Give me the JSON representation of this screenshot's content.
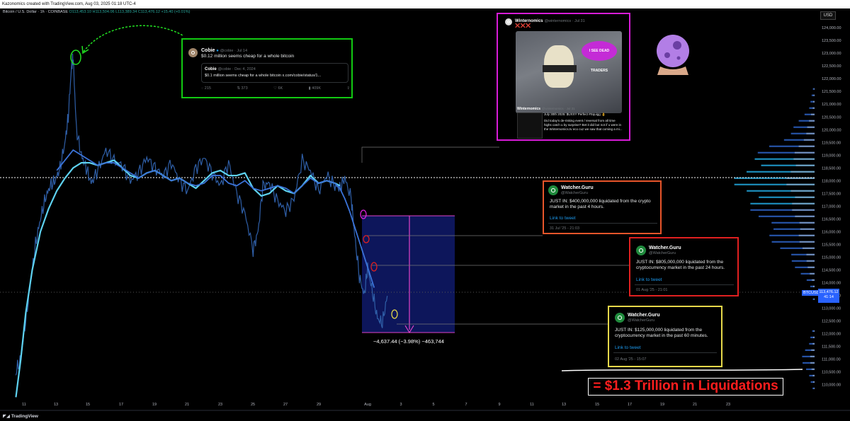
{
  "header": {
    "attribution": "Kazonomics created with TradingView.com, Aug 03, 2025 01:18 UTC-4",
    "symbol": "Bitcoin / U.S. Dollar · 1h · COINBASE",
    "ohlc_o": "O113,453.10",
    "ohlc_h": "H113,504.06",
    "ohlc_l": "L113,389.34",
    "ohlc_c": "C113,476.12",
    "change": "+15.40 (+0.01%)",
    "currency": "USD"
  },
  "price_tag": {
    "symbol": "BTCUSD",
    "price": "113,476.12",
    "countdown": "41:14"
  },
  "measure": {
    "text": "−4,637.44 (−3.98%) −463,744"
  },
  "footer": {
    "brand": "TradingView"
  },
  "callout": {
    "text": "= $1.3 Trillion in Liquidations"
  },
  "tweets": {
    "cobie": {
      "name": "Cobie",
      "handle": "@cobie · Jul 14",
      "text": "$0.12 million seems cheap for a whole bitcoin",
      "quote_name": "Cobie",
      "quote_handle": "@cobie · Dec 4, 2024",
      "quote_text": "$0.1 million seems cheap for a whole bitcoin x.com/cobie/status/1...",
      "replies": "215",
      "retweets": "373",
      "likes": "6K",
      "views": "409K"
    },
    "winternomics": {
      "name": "Winternomics",
      "handle": "@winternomics · Jul 31",
      "text": "❌❌❌",
      "speech": "I SEE DEAD TRADERS",
      "quote_name": "Winternomics",
      "quote_handle": "@winternomics · Jul 31",
      "quote_line1": "July 30th 2025: $UXXY Perfect #Squigg 👌",
      "quote_line2": "Did today's de-risking event / reversal from all time",
      "quote_line3": "highs catch u by surprise? Bet it did but not if u were in",
      "quote_line4": "the Winternomics.tv eco cuz we saw that coming a mi..."
    },
    "wg1": {
      "name": "Watcher.Guru",
      "handle": "@WatcherGuru",
      "text": "JUST IN: $400,000,000 liquidated from the crypto market in the past 4 hours.",
      "link": "Link to tweet",
      "date": "31 Jul '25 - 21:03"
    },
    "wg2": {
      "name": "Watcher.Guru",
      "handle": "@WatcherGuru",
      "text": "JUST IN: $805,000,000 liquidated from the cryptocurrency market in the past 24 hours.",
      "link": "Link to tweet",
      "date": "01 Aug '25 - 21:01"
    },
    "wg3": {
      "name": "Watcher.Guru",
      "handle": "@WatcherGuru",
      "text": "JUST IN: $125,000,000 liquidated from the cryptocurrency market in the past 60 minutes.",
      "link": "Link to tweet",
      "date": "02 Aug '25 - 15:07"
    }
  },
  "chart_data": {
    "type": "line",
    "title": "Bitcoin / U.S. Dollar · 1h · COINBASE",
    "ylim": [
      109400,
      124700
    ],
    "y_ticks": [
      110000,
      110500,
      111000,
      111500,
      112000,
      112500,
      113000,
      113500,
      114000,
      114500,
      115000,
      115500,
      116000,
      116500,
      117000,
      117500,
      118000,
      118500,
      119000,
      119500,
      120000,
      120500,
      121000,
      121500,
      122000,
      122500,
      123000,
      123500,
      124000
    ],
    "x_ticks": [
      "11",
      "13",
      "15",
      "17",
      "19",
      "21",
      "23",
      "25",
      "27",
      "29",
      "Aug",
      "3",
      "5",
      "7",
      "9",
      "11",
      "13",
      "15",
      "17",
      "19",
      "21",
      "23"
    ],
    "x_range": [
      10.5,
      24
    ],
    "series": [
      {
        "type": "price",
        "color": "#2f5fa8",
        "x": [
          10.5,
          10.8,
          11.1,
          11.4,
          11.7,
          12.0,
          12.3,
          12.6,
          12.9,
          13.2,
          13.5,
          13.7,
          13.9,
          14.0,
          14.2,
          14.5,
          14.8,
          15.1,
          15.5,
          16.0,
          16.5,
          17.0,
          17.5,
          18.0,
          18.5,
          19.0,
          19.5,
          20.0,
          20.5,
          21.0,
          21.5,
          22.0,
          22.5,
          23.0,
          23.5,
          24.0,
          24.5,
          25.0,
          25.3,
          25.6,
          26.0,
          26.5,
          27.0,
          27.5,
          28.0,
          28.5,
          29.0,
          29.5,
          30.0,
          30.3,
          30.6,
          31.0,
          31.2,
          31.5,
          31.8,
          32.0,
          32.3,
          32.6,
          32.9,
          33.2
        ],
        "y": [
          110500,
          111000,
          112500,
          114000,
          115500,
          116500,
          117300,
          117800,
          118000,
          118500,
          119500,
          120500,
          122500,
          122800,
          120000,
          119000,
          118500,
          117900,
          118400,
          119200,
          118800,
          118600,
          118000,
          118300,
          118900,
          118500,
          118200,
          118700,
          118000,
          117600,
          118500,
          118900,
          118300,
          117800,
          118700,
          117500,
          116700,
          115300,
          116000,
          117800,
          117900,
          117200,
          116800,
          117300,
          118800,
          118400,
          117600,
          118200,
          117800,
          117700,
          118100,
          117300,
          115900,
          114200,
          113500,
          114600,
          113600,
          112600,
          112400,
          113476
        ]
      },
      {
        "type": "moving-average",
        "color": "#5ed2f0",
        "x": [
          10.5,
          10.8,
          11.1,
          11.5,
          12.0,
          12.5,
          13.0,
          13.5,
          14.0,
          14.5,
          15.0,
          15.5,
          16.0,
          16.5,
          17.0,
          17.5,
          18.0,
          18.5,
          19.0,
          19.5,
          20.0,
          20.5,
          21.0,
          21.5,
          22.0,
          22.5,
          23.0,
          23.5,
          24.0,
          24.5,
          25.0,
          25.5,
          26.0,
          26.5,
          27.0,
          27.5,
          28.0,
          28.5,
          29.0,
          29.5,
          30.0,
          30.3
        ],
        "y": [
          109500,
          111000,
          112800,
          114500,
          116000,
          116900,
          117600,
          118100,
          118500,
          118700,
          118700,
          118600,
          118700,
          118800,
          118500,
          118200,
          118100,
          118300,
          118400,
          118200,
          118000,
          118100,
          117900,
          117700,
          118000,
          118300,
          118400,
          118200,
          118200,
          118300,
          117700,
          117400,
          117500,
          117800,
          117600,
          117500,
          117800,
          118200,
          117900,
          118000,
          117900,
          117800
        ]
      },
      {
        "type": "moving-average-2",
        "color": "#3b73d8",
        "x": [
          13.0,
          13.5,
          14.0,
          14.5,
          15.0,
          15.5,
          16.0,
          16.5,
          17.0,
          17.5,
          18.0,
          18.5,
          19.0,
          19.5,
          20.0,
          20.5,
          21.0,
          21.5,
          22.0,
          22.5,
          23.0,
          23.5,
          24.0,
          24.5,
          25.0,
          25.5,
          26.0,
          26.5,
          27.0,
          27.5,
          28.0,
          28.5,
          29.0,
          29.5,
          30.0,
          30.3,
          30.6,
          30.9,
          31.2,
          31.5,
          31.8,
          32.1,
          32.4
        ],
        "y": [
          118400,
          118800,
          119200,
          119000,
          118800,
          118600,
          118700,
          118700,
          118500,
          118300,
          118100,
          118300,
          118400,
          118200,
          118000,
          118100,
          117900,
          117800,
          117900,
          118200,
          118200,
          117900,
          117800,
          118000,
          117700,
          117600,
          117700,
          117800,
          117700,
          117500,
          117800,
          118100,
          117900,
          118000,
          117900,
          117700,
          117300,
          116800,
          116200,
          115600,
          115000,
          114400,
          113800
        ]
      }
    ],
    "volume_profile": "right-side horizontal histogram, heaviest around 117500-118500",
    "measure_box": {
      "from_price": 117111,
      "to_price": 112474,
      "change": "−4,637.44 (−3.98%)"
    }
  },
  "colors": {
    "green_box": "#12c912",
    "magenta_box": "#d81bd8",
    "red_box": "#e02020",
    "orange_box": "#e8552a",
    "yellow_box": "#e6d84a",
    "measure_fill": "#0f1a6b",
    "measure_line": "#e043c8"
  }
}
